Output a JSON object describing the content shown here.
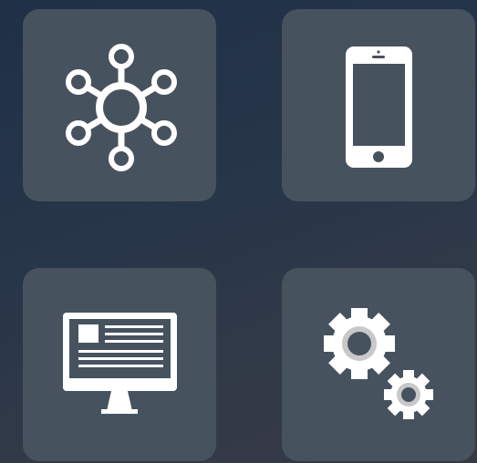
{
  "colors": {
    "background_top": "#1f3047",
    "background_bottom": "#363a44",
    "tile": "#47525f",
    "icon": "#ffffff",
    "gear_inner_ring": "#c8c8c8"
  },
  "tiles": [
    {
      "icon": "network-hub-icon"
    },
    {
      "icon": "smartphone-icon"
    },
    {
      "icon": "desktop-monitor-icon"
    },
    {
      "icon": "gears-icon"
    }
  ]
}
